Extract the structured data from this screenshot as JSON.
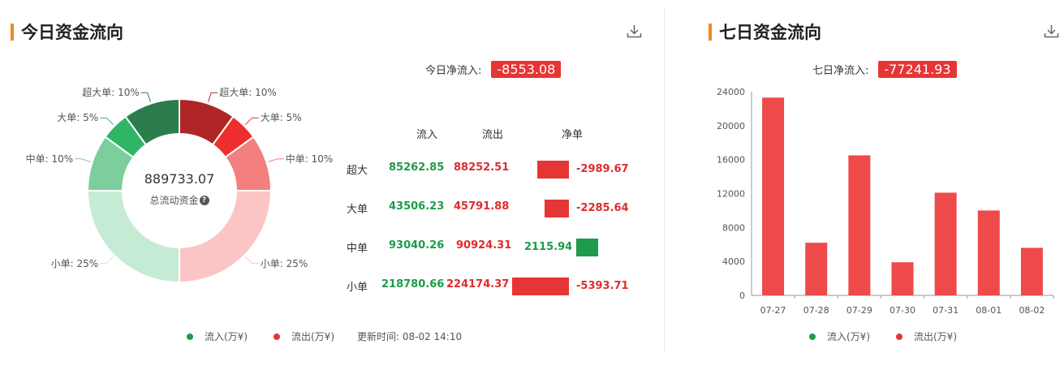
{
  "today_panel": {
    "title": "今日资金流向",
    "net_inflow_label": "今日净流入:",
    "net_inflow_value": "-8553.08",
    "donut": {
      "total_value": "889733.07",
      "total_label": "总流动资金",
      "help_icon": "question-circle-icon",
      "segments": [
        {
          "label": "超大单: 10%",
          "side": "out",
          "percent": 10,
          "color": "#b02525"
        },
        {
          "label": "大单: 5%",
          "side": "out",
          "percent": 5,
          "color": "#ee2e2e"
        },
        {
          "label": "中单: 10%",
          "side": "out",
          "percent": 10,
          "color": "#f37f7f"
        },
        {
          "label": "小单: 25%",
          "side": "out",
          "percent": 25,
          "color": "#fcc5c5"
        },
        {
          "label": "小单: 25%",
          "side": "in",
          "percent": 25,
          "color": "#c5ebd5"
        },
        {
          "label": "中单: 10%",
          "side": "in",
          "percent": 10,
          "color": "#7ccf9c"
        },
        {
          "label": "大单: 5%",
          "side": "in",
          "percent": 5,
          "color": "#2fb664"
        },
        {
          "label": "超大单: 10%",
          "side": "in",
          "percent": 10,
          "color": "#2b7d4c"
        }
      ]
    },
    "table": {
      "headers": {
        "inflow": "流入",
        "outflow": "流出",
        "net": "净单"
      },
      "rows": [
        {
          "label": "超大",
          "inflow": "85262.85",
          "outflow": "88252.51",
          "net": "-2989.67",
          "net_value": -2989.67
        },
        {
          "label": "大单",
          "inflow": "43506.23",
          "outflow": "45791.88",
          "net": "-2285.64",
          "net_value": -2285.64
        },
        {
          "label": "中单",
          "inflow": "93040.26",
          "outflow": "90924.31",
          "net": "2115.94",
          "net_value": 2115.94
        },
        {
          "label": "小单",
          "inflow": "218780.66",
          "outflow": "224174.37",
          "net": "-5393.71",
          "net_value": -5393.71
        }
      ]
    },
    "legend": {
      "inflow": "流入(万¥)",
      "outflow": "流出(万¥)",
      "updated": "更新时间: 08-02 14:10"
    }
  },
  "week_panel": {
    "title": "七日资金流向",
    "net_inflow_label": "七日净流入:",
    "net_inflow_value": "-77241.93",
    "legend": {
      "inflow": "流入(万¥)",
      "outflow": "流出(万¥)"
    }
  },
  "colors": {
    "accent": "#f08a1c",
    "inflow": "#1e9a4a",
    "outflow": "#e63535",
    "bar": "#ee4a4a"
  },
  "chart_data": {
    "type": "bar",
    "categories": [
      "07-27",
      "07-28",
      "07-29",
      "07-30",
      "07-31",
      "08-01",
      "08-02"
    ],
    "values": [
      23300,
      6200,
      16500,
      3900,
      12100,
      10000,
      5600
    ],
    "ylim": [
      0,
      24000
    ],
    "yticks": [
      "0",
      "4000",
      "8000",
      "12000",
      "16000",
      "20000",
      "24000"
    ],
    "grid": false,
    "legend_position": "bottom",
    "legend_entries": [
      "流入(万¥)",
      "流出(万¥)"
    ]
  }
}
